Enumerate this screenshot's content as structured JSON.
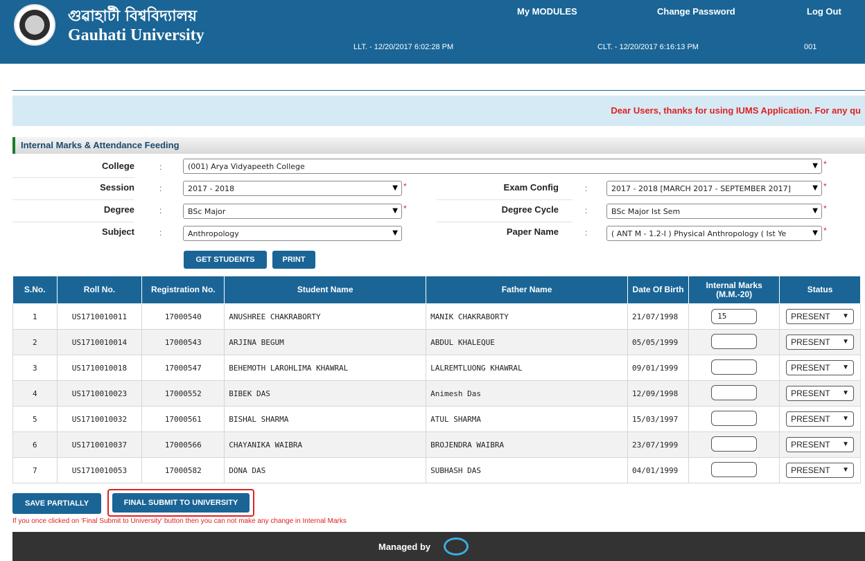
{
  "header": {
    "name_local": "গুৱাহাটী বিশ্ববিদ্যালয়",
    "name": "Gauhati University",
    "links": {
      "modules": "My MODULES",
      "password": "Change Password",
      "logout": "Log Out"
    },
    "llt": "LLT. - 12/20/2017 6:02:28 PM",
    "clt": "CLT. - 12/20/2017 6:16:13 PM",
    "code": "001"
  },
  "notice": "Dear Users, thanks for using IUMS Application. For any qu",
  "section_title": "Internal Marks & Attendance Feeding",
  "form": {
    "college": {
      "label": "College",
      "value": "(001) Arya Vidyapeeth College"
    },
    "session": {
      "label": "Session",
      "value": "2017 - 2018"
    },
    "exam_config": {
      "label": "Exam Config",
      "value": "2017 - 2018 [MARCH 2017 - SEPTEMBER 2017]"
    },
    "degree": {
      "label": "Degree",
      "value": "BSc Major"
    },
    "degree_cycle": {
      "label": "Degree Cycle",
      "value": "BSc Major Ist Sem"
    },
    "subject": {
      "label": "Subject",
      "value": "Anthropology"
    },
    "paper_name": {
      "label": "Paper Name",
      "value": "( ANT M - 1.2-I ) Physical Anthropology ( Ist Ye"
    },
    "colon": ":",
    "required": "*",
    "arrow": "▼"
  },
  "buttons": {
    "get_students": "GET STUDENTS",
    "print": "PRINT",
    "save_partially": "SAVE PARTIALLY",
    "final_submit": "FINAL SUBMIT TO UNIVERSITY"
  },
  "table": {
    "headers": [
      "S.No.",
      "Roll No.",
      "Registration No.",
      "Student Name",
      "Father Name",
      "Date Of Birth",
      "Internal Marks (M.M.-20)",
      "Status"
    ],
    "rows": [
      {
        "sno": "1",
        "roll": "US1710010011",
        "reg": "17000540",
        "student": "ANUSHREE CHAKRABORTY",
        "father": "MANIK CHAKRABORTY",
        "dob": "21/07/1998",
        "marks": "15",
        "status": "PRESENT"
      },
      {
        "sno": "2",
        "roll": "US1710010014",
        "reg": "17000543",
        "student": "ARJINA BEGUM",
        "father": "ABDUL KHALEQUE",
        "dob": "05/05/1999",
        "marks": "",
        "status": "PRESENT"
      },
      {
        "sno": "3",
        "roll": "US1710010018",
        "reg": "17000547",
        "student": "BEHEMOTH LAROHLIMA KHAWRAL",
        "father": "LALREMTLUONG KHAWRAL",
        "dob": "09/01/1999",
        "marks": "",
        "status": "PRESENT"
      },
      {
        "sno": "4",
        "roll": "US1710010023",
        "reg": "17000552",
        "student": "BIBEK DAS",
        "father": "Animesh Das",
        "dob": "12/09/1998",
        "marks": "",
        "status": "PRESENT"
      },
      {
        "sno": "5",
        "roll": "US1710010032",
        "reg": "17000561",
        "student": "BISHAL SHARMA",
        "father": "ATUL SHARMA",
        "dob": "15/03/1997",
        "marks": "",
        "status": "PRESENT"
      },
      {
        "sno": "6",
        "roll": "US1710010037",
        "reg": "17000566",
        "student": "CHAYANIKA WAIBRA",
        "father": "BROJENDRA WAIBRA",
        "dob": "23/07/1999",
        "marks": "",
        "status": "PRESENT"
      },
      {
        "sno": "7",
        "roll": "US1710010053",
        "reg": "17000582",
        "student": "DONA DAS",
        "father": "SUBHASH DAS",
        "dob": "04/01/1999",
        "marks": "",
        "status": "PRESENT"
      }
    ]
  },
  "warning": "If you once clicked on 'Final Submit to University' button then you can not make any change in Internal Marks",
  "footer": {
    "managed_by": "Managed by"
  },
  "icons": {
    "logo": "university-seal-icon",
    "footer_logo": "company-logo-icon",
    "dropdown": "chevron-down-icon"
  },
  "colors": {
    "primary": "#1a6596",
    "notice_bg": "#d6eaf5",
    "alert": "#e02020",
    "footer_bg": "#333333",
    "section_accent": "#1c7a2e"
  }
}
